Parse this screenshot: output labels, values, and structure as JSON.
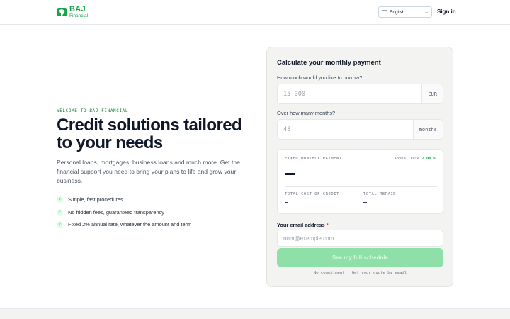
{
  "header": {
    "brand": "BAJ",
    "brand_sub": "Financial",
    "language_selected": "English",
    "signin_label": "Sign in",
    "accent_color": "#16a34a"
  },
  "hero": {
    "eyebrow": "WELCOME TO BAJ FINANCIAL",
    "title": "Credit solutions tailored to your needs",
    "description": "Personal loans, mortgages, business loans and much more. Get the financial support you need to bring your plans to life and grow your business.",
    "features": [
      "Simple, fast procedures",
      "No hidden fees, guaranteed transparency",
      "Fixed 2% annual rate, whatever the amount and term"
    ]
  },
  "calculator": {
    "title": "Calculate your monthly payment",
    "amount_label": "How much would you like to borrow?",
    "amount_placeholder": "15 000",
    "amount_unit": "EUR",
    "months_label": "Over how many months?",
    "months_placeholder": "48",
    "months_unit": "months",
    "result": {
      "fixed_label": "FIXED MONTHLY PAYMENT",
      "rate_label": "Annual rate",
      "rate_value": "2.00 %",
      "total_cost_label": "TOTAL COST OF CREDIT",
      "total_repaid_label": "TOTAL REPAID"
    },
    "email_label": "Your email address",
    "email_required_mark": "*",
    "email_placeholder": "nom@exemple.com",
    "cta_label": "See my full schedule",
    "footnote": "No commitment · Get your quote by email"
  }
}
